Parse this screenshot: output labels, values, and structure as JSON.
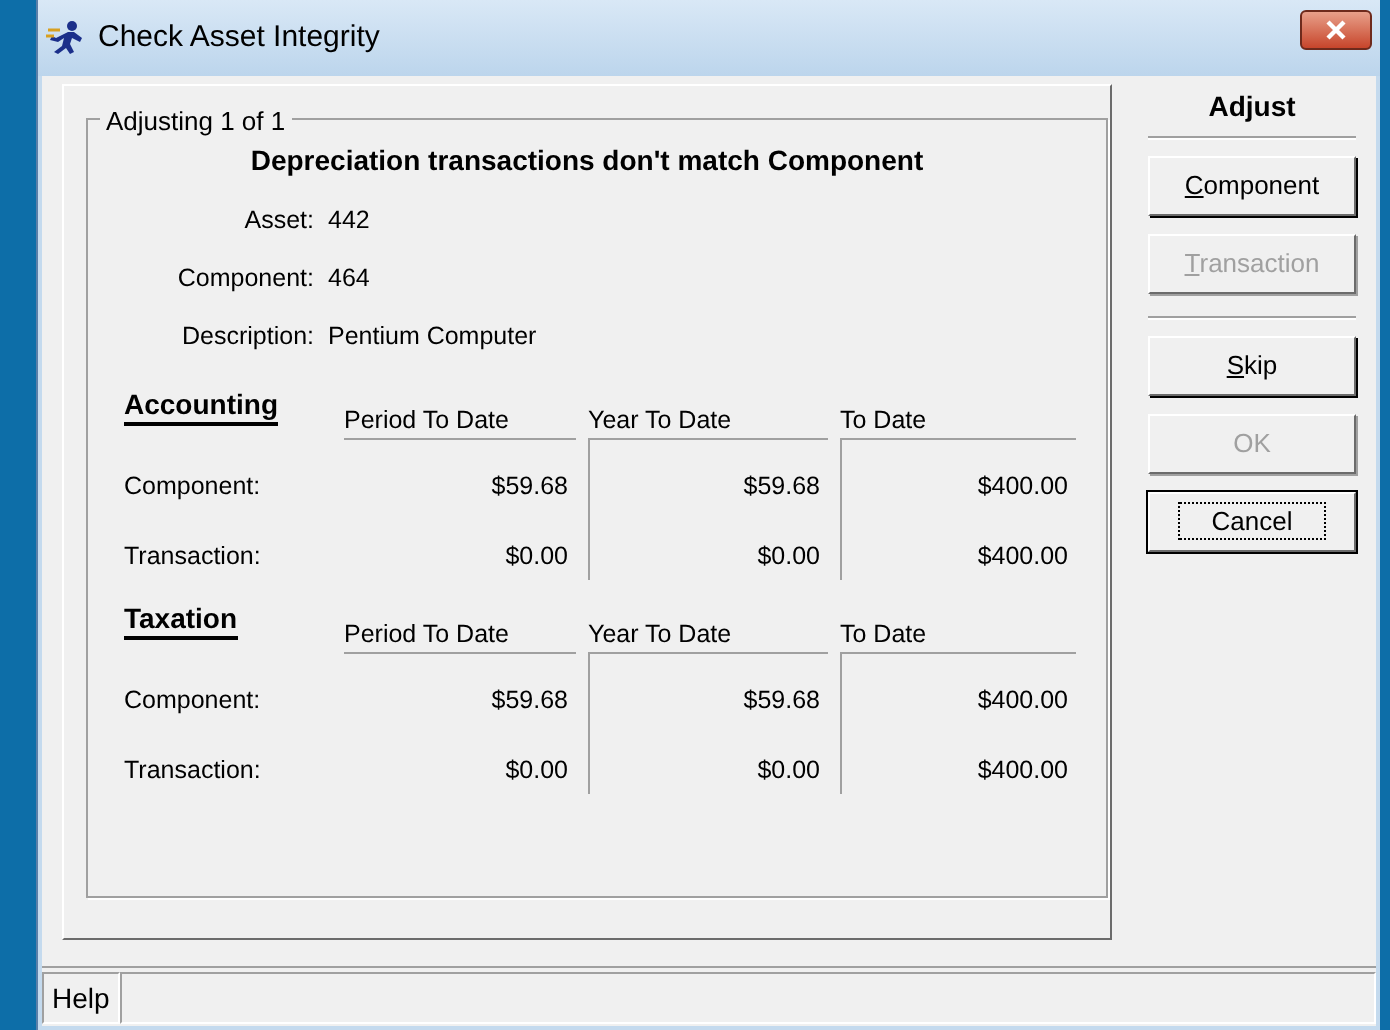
{
  "window": {
    "title": "Check Asset Integrity"
  },
  "group": {
    "legend": "Adjusting 1 of 1",
    "heading": "Depreciation transactions don't match Component",
    "fields": [
      {
        "label": "Asset:",
        "value": "442"
      },
      {
        "label": "Component:",
        "value": "464"
      },
      {
        "label": "Description:",
        "value": "Pentium Computer"
      }
    ],
    "sections": [
      {
        "title": "Accounting",
        "columns": [
          "Period To Date",
          "Year To Date",
          "To Date"
        ],
        "rows": [
          {
            "label": "Component:",
            "values": [
              "$59.68",
              "$59.68",
              "$400.00"
            ]
          },
          {
            "label": "Transaction:",
            "values": [
              "$0.00",
              "$0.00",
              "$400.00"
            ]
          }
        ]
      },
      {
        "title": "Taxation",
        "columns": [
          "Period To Date",
          "Year To Date",
          "To Date"
        ],
        "rows": [
          {
            "label": "Component:",
            "values": [
              "$59.68",
              "$59.68",
              "$400.00"
            ]
          },
          {
            "label": "Transaction:",
            "values": [
              "$0.00",
              "$0.00",
              "$400.00"
            ]
          }
        ]
      }
    ]
  },
  "adjust": {
    "title": "Adjust",
    "buttons": [
      {
        "label": "Component",
        "mnemonic": true,
        "disabled": false,
        "focused": false
      },
      {
        "label": "Transaction",
        "mnemonic": true,
        "disabled": true,
        "focused": false
      },
      {
        "kind": "separator"
      },
      {
        "label": "Skip",
        "mnemonic": true,
        "disabled": false,
        "focused": false
      },
      {
        "label": "OK",
        "mnemonic": false,
        "disabled": true,
        "focused": false
      },
      {
        "label": "Cancel",
        "mnemonic": false,
        "disabled": false,
        "focused": true
      }
    ]
  },
  "status_bar": {
    "panels": [
      "Help"
    ]
  }
}
